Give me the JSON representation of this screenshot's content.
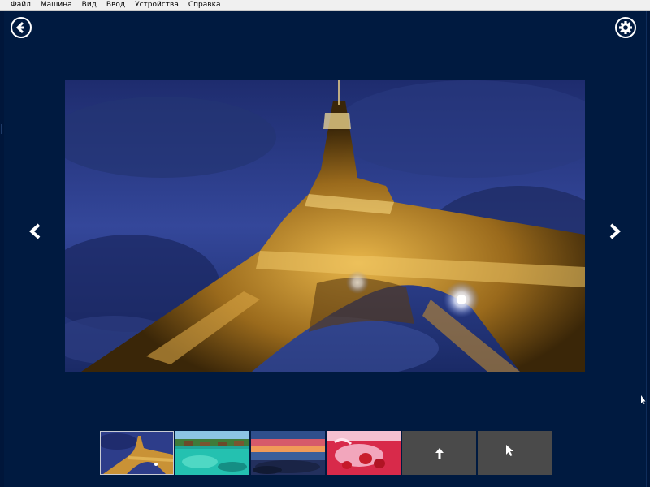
{
  "menu": {
    "items": [
      {
        "label": "Файл"
      },
      {
        "label": "Машина"
      },
      {
        "label": "Вид"
      },
      {
        "label": "Ввод"
      },
      {
        "label": "Устройства"
      },
      {
        "label": "Справка"
      }
    ]
  },
  "toolbar": {
    "back_icon": "back-arrow-icon",
    "settings_icon": "gear-icon"
  },
  "viewer": {
    "prev_icon": "chevron-left-icon",
    "next_icon": "chevron-right-icon",
    "current_photo_subject": "eiffel-tower-night",
    "selected_index": 0
  },
  "thumbnails": [
    {
      "subject": "eiffel-tower",
      "selected": true
    },
    {
      "subject": "tropical-bungalows",
      "selected": false
    },
    {
      "subject": "sunset-seascape",
      "selected": false
    },
    {
      "subject": "strawberry-splash",
      "selected": false
    },
    {
      "icon": "upload-arrow-icon",
      "selected": false
    },
    {
      "icon": "cursor-icon",
      "selected": false
    }
  ],
  "colors": {
    "background": "#001a40",
    "menubar": "#f0f0f0",
    "placeholder_tile": "#4a4a4a",
    "foreground": "#ffffff"
  }
}
